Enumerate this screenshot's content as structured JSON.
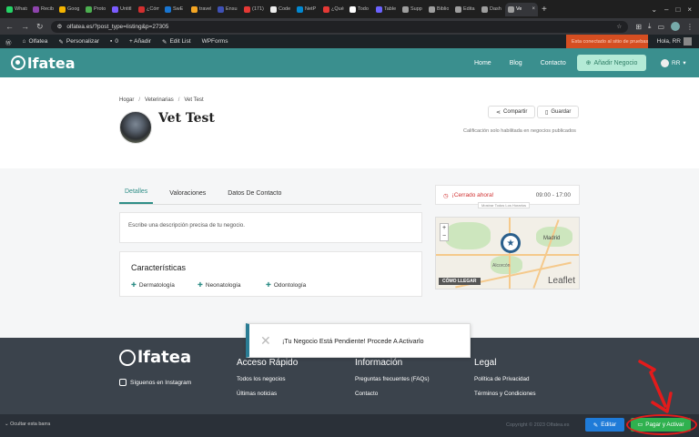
{
  "browser": {
    "tabs": [
      {
        "label": "Whats",
        "color": "#25d366"
      },
      {
        "label": "Recib",
        "color": "#8e44ad"
      },
      {
        "label": "Goog",
        "color": "#f4b400"
      },
      {
        "label": "Proto",
        "color": "#4caf50"
      },
      {
        "label": "Untitl",
        "color": "#7b5cff"
      },
      {
        "label": "¿Cóm",
        "color": "#d32f2f"
      },
      {
        "label": "SwE",
        "color": "#1976d2"
      },
      {
        "label": "travel",
        "color": "#f5a623"
      },
      {
        "label": "Ensu",
        "color": "#3f51b5"
      },
      {
        "label": "(171)",
        "color": "#e53935"
      },
      {
        "label": "Code",
        "color": "#eeeeee"
      },
      {
        "label": "NetP",
        "color": "#0288d1"
      },
      {
        "label": "¿Qué",
        "color": "#e53935"
      },
      {
        "label": "Todo",
        "color": "#ffffff"
      },
      {
        "label": "Table",
        "color": "#6c63ff"
      },
      {
        "label": "Supp",
        "color": "#9e9e9e"
      },
      {
        "label": "Biblio",
        "color": "#9e9e9e"
      },
      {
        "label": "Edita",
        "color": "#9e9e9e"
      },
      {
        "label": "Dash",
        "color": "#9e9e9e"
      },
      {
        "label": "Ve",
        "color": "#9e9e9e",
        "active": true
      }
    ],
    "url": "olfatea.es/?post_type=listing&p=27305"
  },
  "wpbar": {
    "items": [
      "Olfatea",
      "Personalizar",
      "0",
      "+ Añadir",
      "Edit List",
      "WPForms"
    ],
    "alert": "Esta conectado al sitio de pruebas",
    "greeting": "Hola, RR"
  },
  "header": {
    "logo": "lfatea",
    "nav": [
      "Home",
      "Blog",
      "Contacto"
    ],
    "add_button": "Añadir Negocio",
    "user": "RR"
  },
  "listing": {
    "breadcrumbs": [
      "Hogar",
      "Veterinarias",
      "Vet Test"
    ],
    "title": "Vet Test",
    "share_label": "Compartir",
    "save_label": "Guardar",
    "rating_note": "Calificación solo habilitada en negocios publicados",
    "tabs": [
      "Detalles",
      "Valoraciones",
      "Datos De Contacto"
    ],
    "active_tab": "Detalles",
    "description": "Escribe una descripción precisa de tu negocio.",
    "features_title": "Características",
    "features": [
      "Dermatología",
      "Neonatología",
      "Odontología"
    ],
    "closed_label": "¡Cerrado ahora!",
    "hours": "09:00 - 17:00",
    "show_hours": "Mostrar Todos Los Horarios",
    "map": {
      "directions": "CÓMO LLEGAR",
      "attribution": "Leaflet",
      "labels": [
        "Madrid",
        "Alcorcón"
      ]
    }
  },
  "toast": {
    "message": "¡Tu Negocio Está Pendiente! Procede A Activarlo"
  },
  "footer": {
    "logo": "lfatea",
    "instagram": "Síguenos en Instagram",
    "columns": [
      {
        "title": "Acceso Rápido",
        "links": [
          "Todos los negocios",
          "Últimas noticias"
        ]
      },
      {
        "title": "Información",
        "links": [
          "Preguntas frecuentes (FAQs)",
          "Contacto"
        ]
      },
      {
        "title": "Legal",
        "links": [
          "Política de Privacidad",
          "Términos y Condiciones"
        ]
      }
    ]
  },
  "bottom": {
    "hide_bar": "Ocultar esta barra",
    "copyright": "Copyright © 2023 Olfatea.es",
    "edit_label": "Editar",
    "pay_label": "Pagar y Activar"
  },
  "colors": {
    "brand": "#3a8f8e",
    "annotation": "#e31b1b",
    "pay": "#2fb14f",
    "edit": "#1f7bd8"
  }
}
